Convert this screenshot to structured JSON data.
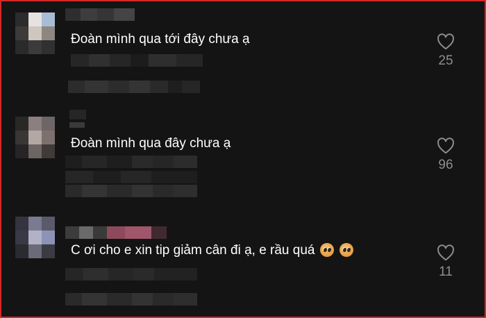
{
  "comments": [
    {
      "text": "Đoàn mình qua tới đây chưa ạ",
      "likes": "25",
      "emojis": 0
    },
    {
      "text": "Đoàn mình qua đây chưa ạ",
      "likes": "96",
      "emojis": 0
    },
    {
      "text": "C ơi cho e xin tip giảm cân đi ạ, e rầu quá",
      "likes": "11",
      "emojis": 2
    }
  ],
  "icons": {
    "like": "heart-outline-icon",
    "emoji": "pleading-face-icon"
  },
  "colors": {
    "background": "#141414",
    "text": "#ffffff",
    "muted": "#8e8e8e",
    "frame": "#d62828"
  }
}
